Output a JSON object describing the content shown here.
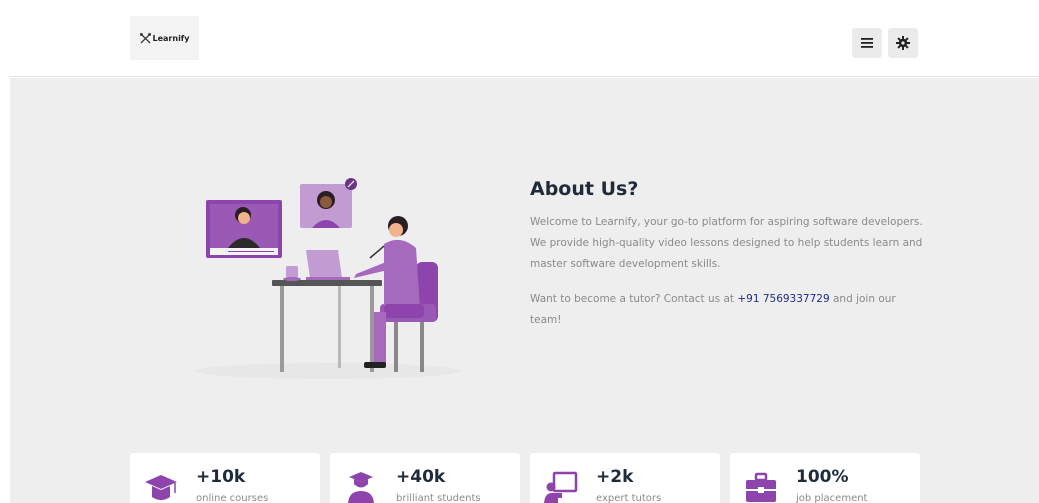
{
  "header": {
    "logo_text": "Learnify",
    "icons": {
      "logo": "crossed-tools-icon",
      "menu": "hamburger-menu-icon",
      "settings": "gear-icon"
    }
  },
  "about": {
    "title": "About Us?",
    "paragraph1": "Welcome to Learnify, your go-to platform for aspiring software developers. We provide high-quality video lessons designed to help students learn and master software development skills.",
    "paragraph2_prefix": "Want to become a tutor? Contact us at ",
    "phone": "+91 7569337729",
    "paragraph2_suffix": " and join our team!"
  },
  "stats": [
    {
      "value": "+10k",
      "label": "online courses",
      "icon": "graduation-cap-icon"
    },
    {
      "value": "+40k",
      "label": "brilliant students",
      "icon": "student-icon"
    },
    {
      "value": "+2k",
      "label": "expert tutors",
      "icon": "teacher-board-icon"
    },
    {
      "value": "100%",
      "label": "job placement",
      "icon": "briefcase-icon"
    }
  ],
  "colors": {
    "accent": "#8e44ad",
    "text_dark": "#1f2a3a",
    "text_muted": "#8a8a8a",
    "link": "#1d2c8a"
  }
}
